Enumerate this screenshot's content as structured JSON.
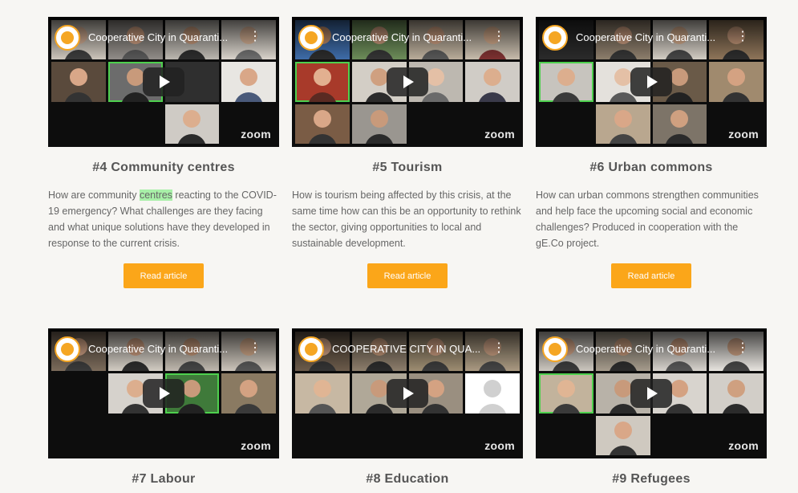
{
  "video_title": "Cooperative City in Quaranti...",
  "video_title_caps": "COOPERATIVE CITY IN QUA...",
  "zoom_label": "zoom",
  "read_label": "Read article",
  "cards": [
    {
      "title": "#4 Community centres",
      "desc_before": "How are community ",
      "desc_highlight": "centres",
      "desc_after": " reacting to the COVID-19 emergency? What challenges are they facing and what unique solutions have they developed in response to the current crisis."
    },
    {
      "title": "#5 Tourism",
      "desc": "How is tourism being affected by this crisis, at the same time how can this be an opportunity to rethink the sector, giving opportunities to local and sustainable development."
    },
    {
      "title": "#6 Urban commons",
      "desc": "How can urban commons strengthen communities and help face the upcoming social and economic challenges? Produced in cooperation with the gE.Co project."
    },
    {
      "title": "#7 Labour"
    },
    {
      "title": "#8 Education"
    },
    {
      "title": "#9 Refugees"
    }
  ],
  "colors": {
    "accent": "#fba619",
    "zoom_active": "#4ed04e",
    "highlight": "#a8f0a8"
  }
}
